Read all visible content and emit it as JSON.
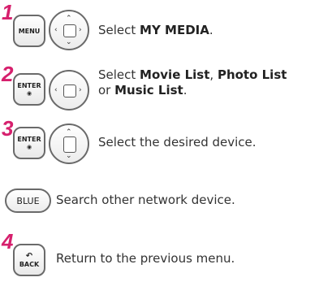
{
  "steps": [
    {
      "number": "1"
    },
    {
      "number": "2"
    },
    {
      "number": "3"
    },
    {
      "number": "4"
    }
  ],
  "keys": {
    "menu": "MENU",
    "enter": "ENTER",
    "enter_dot": "◉",
    "blue": "BLUE",
    "back": "BACK",
    "back_arrow": "↶"
  },
  "instructions": {
    "select_prefix": "Select ",
    "my_media": "MY MEDIA",
    "period": ".",
    "movie_list": "Movie List",
    "comma": ", ",
    "photo_list": "Photo List",
    "or": "or ",
    "music_list": "Music List",
    "select_device": "Select the desired device.",
    "search_network": "Search other network device.",
    "return_menu": "Return to the previous menu."
  },
  "icons": {
    "up": "⌃",
    "down": "⌄",
    "left": "‹",
    "right": "›"
  },
  "accent_color": "#d6206d"
}
